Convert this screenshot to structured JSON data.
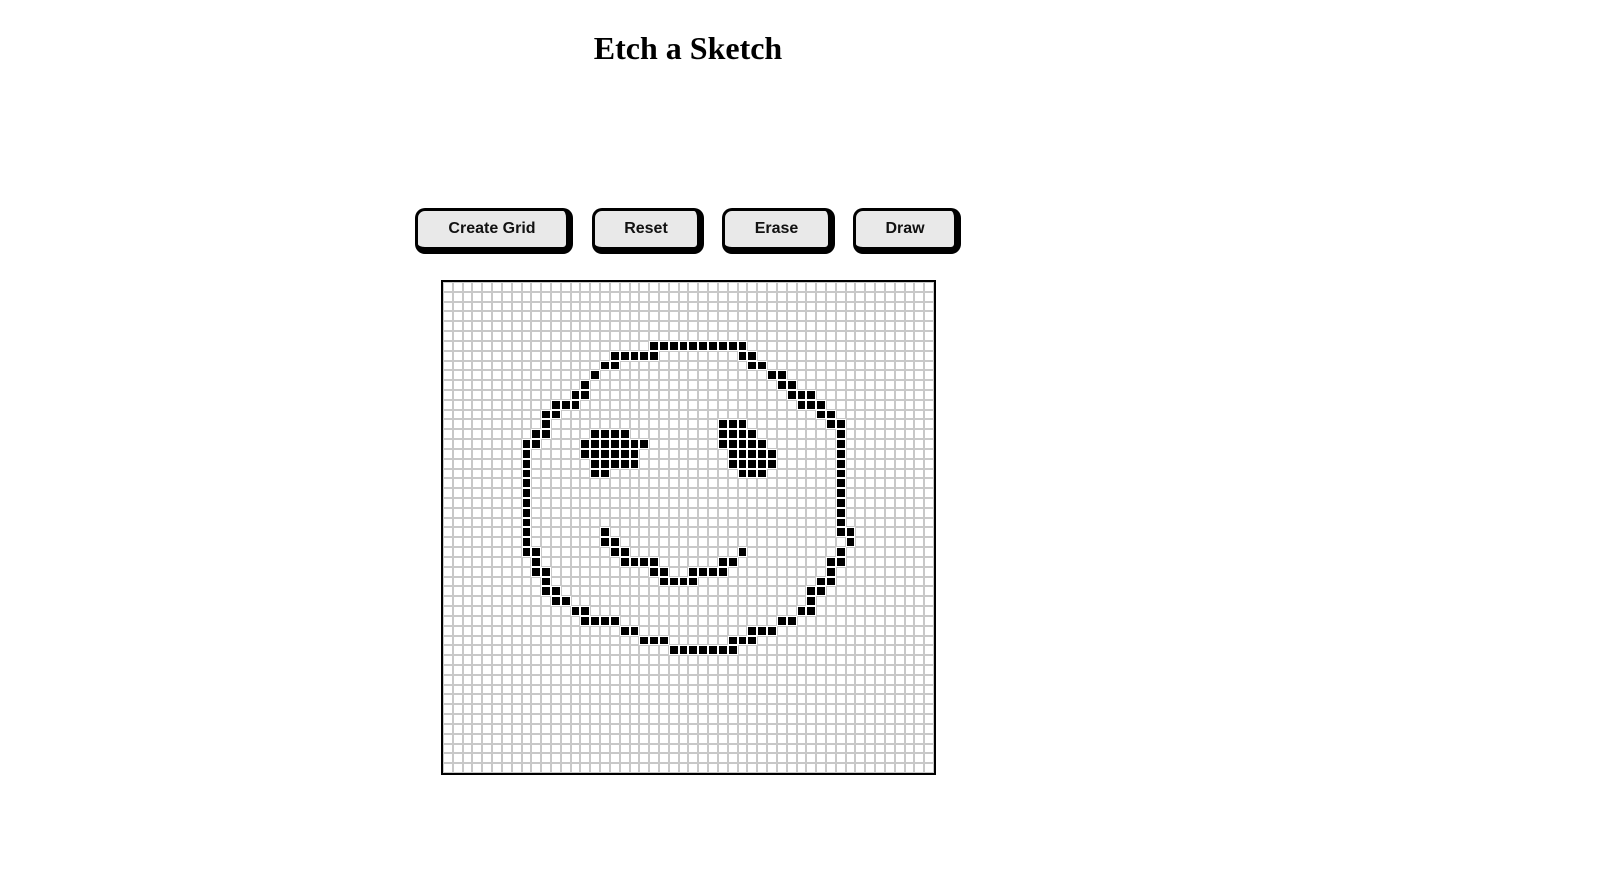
{
  "page": {
    "title": "Etch a Sketch"
  },
  "toolbar": {
    "create_grid_label": "Create Grid",
    "reset_label": "Reset",
    "erase_label": "Erase",
    "draw_label": "Draw"
  },
  "grid": {
    "rows": 50,
    "cols": 50,
    "ink_color": "#000000",
    "filled_cells": [
      [
        6,
        21
      ],
      [
        6,
        22
      ],
      [
        6,
        23
      ],
      [
        6,
        24
      ],
      [
        6,
        25
      ],
      [
        6,
        26
      ],
      [
        6,
        27
      ],
      [
        6,
        28
      ],
      [
        6,
        29
      ],
      [
        6,
        30
      ],
      [
        7,
        17
      ],
      [
        7,
        18
      ],
      [
        7,
        19
      ],
      [
        7,
        20
      ],
      [
        7,
        21
      ],
      [
        7,
        30
      ],
      [
        7,
        31
      ],
      [
        8,
        16
      ],
      [
        8,
        17
      ],
      [
        8,
        31
      ],
      [
        8,
        32
      ],
      [
        9,
        15
      ],
      [
        9,
        33
      ],
      [
        9,
        34
      ],
      [
        10,
        14
      ],
      [
        10,
        34
      ],
      [
        10,
        35
      ],
      [
        11,
        13
      ],
      [
        11,
        14
      ],
      [
        11,
        35
      ],
      [
        11,
        36
      ],
      [
        11,
        37
      ],
      [
        12,
        11
      ],
      [
        12,
        12
      ],
      [
        12,
        13
      ],
      [
        12,
        36
      ],
      [
        12,
        37
      ],
      [
        12,
        38
      ],
      [
        13,
        10
      ],
      [
        13,
        11
      ],
      [
        13,
        38
      ],
      [
        13,
        39
      ],
      [
        14,
        10
      ],
      [
        14,
        28
      ],
      [
        14,
        29
      ],
      [
        14,
        30
      ],
      [
        14,
        39
      ],
      [
        14,
        40
      ],
      [
        15,
        9
      ],
      [
        15,
        10
      ],
      [
        15,
        15
      ],
      [
        15,
        16
      ],
      [
        15,
        17
      ],
      [
        15,
        18
      ],
      [
        15,
        28
      ],
      [
        15,
        29
      ],
      [
        15,
        30
      ],
      [
        15,
        31
      ],
      [
        15,
        40
      ],
      [
        16,
        8
      ],
      [
        16,
        9
      ],
      [
        16,
        14
      ],
      [
        16,
        15
      ],
      [
        16,
        16
      ],
      [
        16,
        17
      ],
      [
        16,
        18
      ],
      [
        16,
        19
      ],
      [
        16,
        20
      ],
      [
        16,
        28
      ],
      [
        16,
        29
      ],
      [
        16,
        30
      ],
      [
        16,
        31
      ],
      [
        16,
        32
      ],
      [
        16,
        40
      ],
      [
        17,
        8
      ],
      [
        17,
        14
      ],
      [
        17,
        15
      ],
      [
        17,
        16
      ],
      [
        17,
        17
      ],
      [
        17,
        18
      ],
      [
        17,
        19
      ],
      [
        17,
        29
      ],
      [
        17,
        30
      ],
      [
        17,
        31
      ],
      [
        17,
        32
      ],
      [
        17,
        33
      ],
      [
        17,
        40
      ],
      [
        18,
        8
      ],
      [
        18,
        15
      ],
      [
        18,
        16
      ],
      [
        18,
        17
      ],
      [
        18,
        18
      ],
      [
        18,
        19
      ],
      [
        18,
        29
      ],
      [
        18,
        30
      ],
      [
        18,
        31
      ],
      [
        18,
        32
      ],
      [
        18,
        33
      ],
      [
        18,
        40
      ],
      [
        19,
        8
      ],
      [
        19,
        15
      ],
      [
        19,
        16
      ],
      [
        19,
        30
      ],
      [
        19,
        31
      ],
      [
        19,
        32
      ],
      [
        19,
        40
      ],
      [
        20,
        8
      ],
      [
        20,
        40
      ],
      [
        21,
        8
      ],
      [
        21,
        40
      ],
      [
        22,
        8
      ],
      [
        22,
        40
      ],
      [
        23,
        8
      ],
      [
        23,
        40
      ],
      [
        24,
        8
      ],
      [
        24,
        40
      ],
      [
        25,
        8
      ],
      [
        25,
        16
      ],
      [
        25,
        40
      ],
      [
        25,
        41
      ],
      [
        26,
        8
      ],
      [
        26,
        16
      ],
      [
        26,
        17
      ],
      [
        26,
        41
      ],
      [
        27,
        8
      ],
      [
        27,
        9
      ],
      [
        27,
        17
      ],
      [
        27,
        18
      ],
      [
        27,
        30
      ],
      [
        27,
        40
      ],
      [
        28,
        9
      ],
      [
        28,
        18
      ],
      [
        28,
        19
      ],
      [
        28,
        20
      ],
      [
        28,
        21
      ],
      [
        28,
        28
      ],
      [
        28,
        29
      ],
      [
        28,
        39
      ],
      [
        28,
        40
      ],
      [
        29,
        9
      ],
      [
        29,
        10
      ],
      [
        29,
        21
      ],
      [
        29,
        22
      ],
      [
        29,
        25
      ],
      [
        29,
        26
      ],
      [
        29,
        27
      ],
      [
        29,
        28
      ],
      [
        29,
        39
      ],
      [
        30,
        10
      ],
      [
        30,
        22
      ],
      [
        30,
        23
      ],
      [
        30,
        24
      ],
      [
        30,
        25
      ],
      [
        30,
        38
      ],
      [
        30,
        39
      ],
      [
        31,
        10
      ],
      [
        31,
        11
      ],
      [
        31,
        37
      ],
      [
        31,
        38
      ],
      [
        32,
        11
      ],
      [
        32,
        12
      ],
      [
        32,
        37
      ],
      [
        33,
        13
      ],
      [
        33,
        14
      ],
      [
        33,
        36
      ],
      [
        33,
        37
      ],
      [
        34,
        14
      ],
      [
        34,
        15
      ],
      [
        34,
        16
      ],
      [
        34,
        17
      ],
      [
        34,
        34
      ],
      [
        34,
        35
      ],
      [
        35,
        18
      ],
      [
        35,
        19
      ],
      [
        35,
        31
      ],
      [
        35,
        32
      ],
      [
        35,
        33
      ],
      [
        36,
        20
      ],
      [
        36,
        21
      ],
      [
        36,
        22
      ],
      [
        36,
        29
      ],
      [
        36,
        30
      ],
      [
        36,
        31
      ],
      [
        37,
        23
      ],
      [
        37,
        24
      ],
      [
        37,
        25
      ],
      [
        37,
        26
      ],
      [
        37,
        27
      ],
      [
        37,
        28
      ],
      [
        37,
        29
      ]
    ]
  }
}
